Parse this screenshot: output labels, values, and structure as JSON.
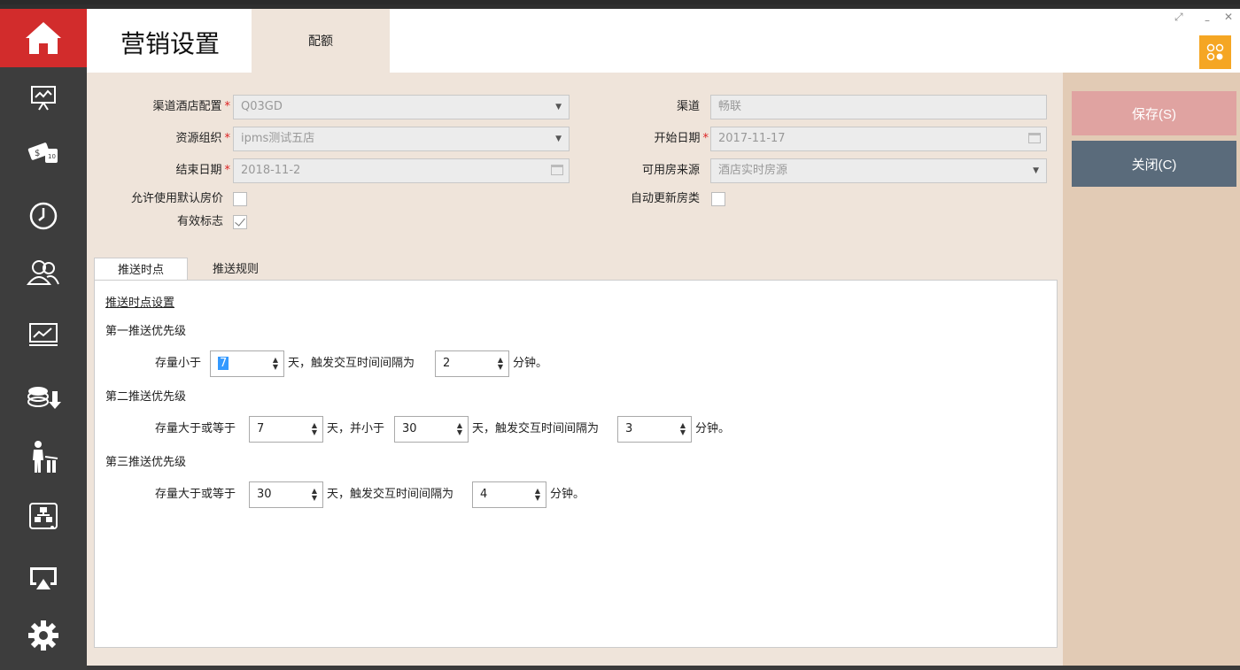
{
  "sidebar": {
    "items": [
      "home-icon",
      "presentation-icon",
      "money-icon",
      "clock-icon",
      "users-icon",
      "trend-chart-icon",
      "coins-icon",
      "guest-luggage-icon",
      "org-chart-icon",
      "screen-cast-icon",
      "gear-icon"
    ]
  },
  "header": {
    "title": "营销设置",
    "tab": "配额"
  },
  "actions": {
    "save": "保存(S)",
    "close": "关闭(C)"
  },
  "form": {
    "channel_hotel_config": {
      "label": "渠道酒店配置",
      "value": "Q03GD"
    },
    "channel": {
      "label": "渠道",
      "value": "畅联"
    },
    "resource_org": {
      "label": "资源组织",
      "value": "ipms测试五店"
    },
    "start_date": {
      "label": "开始日期",
      "value": "2017-11-17"
    },
    "end_date": {
      "label": "结束日期",
      "value": "2018-11-2"
    },
    "room_source": {
      "label": "可用房来源",
      "value": "酒店实时房源"
    },
    "allow_default_price": {
      "label": "允许使用默认房价",
      "checked": false
    },
    "auto_update_room_type": {
      "label": "自动更新房类",
      "checked": false
    },
    "valid_flag": {
      "label": "有效标志",
      "checked": true
    },
    "required_mark": "*"
  },
  "tabs": {
    "push_time": "推送时点",
    "push_rule": "推送规则"
  },
  "push": {
    "section_title": "推送时点设置",
    "p1": {
      "title": "第一推送优先级",
      "prefix": "存量小于",
      "v1": "7",
      "mid": "天，触发交互时间间隔为",
      "v2": "2",
      "suffix": "分钟。"
    },
    "p2": {
      "title": "第二推送优先级",
      "prefix": "存量大于或等于",
      "v1": "7",
      "mid1": "天，并小于",
      "v2": "30",
      "mid2": "天，触发交互时间间隔为",
      "v3": "3",
      "suffix": "分钟。"
    },
    "p3": {
      "title": "第三推送优先级",
      "prefix": "存量大于或等于",
      "v1": "30",
      "mid": "天，触发交互时间间隔为",
      "v2": "4",
      "suffix": "分钟。"
    }
  },
  "colors": {
    "accent": "#d22c2c",
    "user_btn": "#f5a623",
    "save_btn": "#e0a3a1",
    "close_btn": "#5a6b7b"
  }
}
